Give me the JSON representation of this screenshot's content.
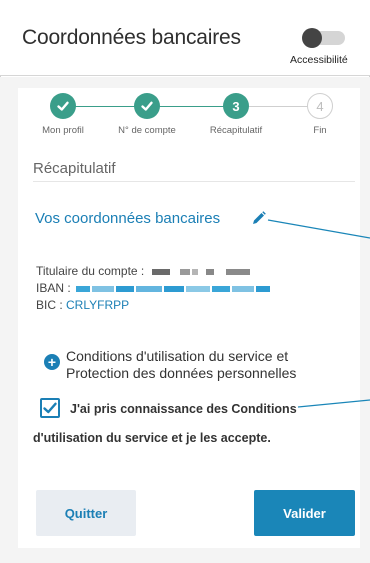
{
  "header": {
    "title": "Coordonnées bancaires",
    "accessibility_label": "Accessibilité",
    "accessibility_on": false
  },
  "stepper": {
    "steps": [
      {
        "label": "Mon profil",
        "state": "done",
        "number": ""
      },
      {
        "label": "N° de compte",
        "state": "done",
        "number": ""
      },
      {
        "label": "Récapitulatif",
        "state": "current",
        "number": "3"
      },
      {
        "label": "Fin",
        "state": "todo",
        "number": "4"
      }
    ]
  },
  "recap": {
    "section_title": "Récapitulatif",
    "bank_title": "Vos coordonnées bancaires",
    "holder_label": "Titulaire du compte :",
    "iban_label": "IBAN :",
    "bic_label": "BIC :",
    "bic_value": "CRLYFRPP"
  },
  "conditions": {
    "link_line1": "Conditions d'utilisation du service et",
    "link_line2": "Protection des données personnelles",
    "accept_line1": "J'ai pris connaissance des Conditions",
    "accept_line2": "d'utilisation du service et je les accepte.",
    "accepted": true
  },
  "actions": {
    "quit_label": "Quitter",
    "validate_label": "Valider"
  },
  "colors": {
    "accent": "#1b7fb5",
    "step_done": "#3a9e8a"
  }
}
